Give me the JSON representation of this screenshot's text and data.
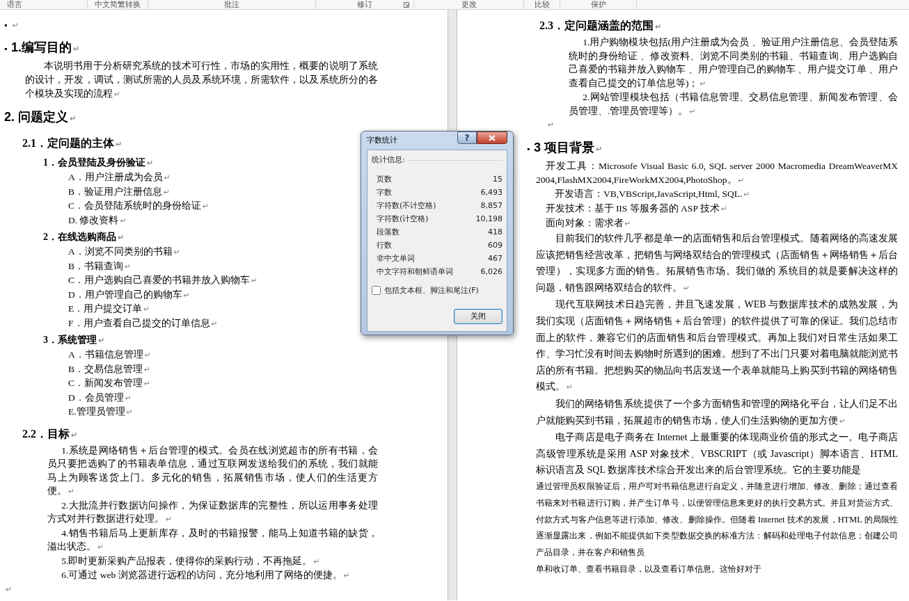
{
  "ribbon_groups": [
    {
      "label": "语言",
      "launcher": false
    },
    {
      "label": "中文简繁转换",
      "launcher": false
    },
    {
      "label": "批注",
      "launcher": false
    },
    {
      "label": "修订",
      "launcher": true
    },
    {
      "label": "更改",
      "launcher": false
    },
    {
      "label": "比较",
      "launcher": false
    },
    {
      "label": "保护",
      "launcher": false
    }
  ],
  "left_page": {
    "blocks": [
      {
        "kind": "blank",
        "keep": "▪",
        "mark": "↵"
      },
      {
        "kind": "h1",
        "keep": "▪",
        "text": "1.编写目的",
        "mark": "↵"
      },
      {
        "kind": "para",
        "text": "本说明书用于分析研究系统的技术可行性，市场的实用性，概要的说明了系统的设计，开发，调试，测试所需的人员及系统环境，所需软件，以及系统所分的各个模块及实现的流程",
        "mark": "↵"
      },
      {
        "kind": "h1",
        "text": "2. 问题定义",
        "mark": "↵"
      },
      {
        "kind": "h2",
        "text": "2.1．定问题的主体",
        "mark": "↵"
      },
      {
        "kind": "sub",
        "text": "1．会员登陆及身份验证",
        "mark": "↵"
      },
      {
        "kind": "item",
        "text": "A．用户注册成为会员",
        "mark": "↵"
      },
      {
        "kind": "item",
        "text": "B．验证用户注册信息",
        "mark": "↵"
      },
      {
        "kind": "item",
        "text": "C．会员登陆系统时的身份给证",
        "mark": "↵"
      },
      {
        "kind": "item",
        "text": "D. 修改资料",
        "mark": "↵"
      },
      {
        "kind": "sub",
        "text": "2．在线选购商品",
        "mark": "↵"
      },
      {
        "kind": "item",
        "text": "A．浏览不同类别的书籍",
        "mark": "↵"
      },
      {
        "kind": "item",
        "text": "B．书籍查询",
        "mark": "↵"
      },
      {
        "kind": "item",
        "text": "C．用户选购自己喜爱的书籍并放入购物车",
        "mark": "↵"
      },
      {
        "kind": "item",
        "text": "D．用户管理自己的购物车",
        "mark": "↵"
      },
      {
        "kind": "item",
        "text": "E．用户提交订单",
        "mark": "↵"
      },
      {
        "kind": "item",
        "text": "F．用户查看自己提交的订单信息",
        "mark": "↵"
      },
      {
        "kind": "sub",
        "text": "3．系统管理",
        "mark": "↵"
      },
      {
        "kind": "item",
        "text": "A．书籍信息管理",
        "mark": "↵"
      },
      {
        "kind": "item",
        "text": "B．交易信息管理",
        "mark": "↵"
      },
      {
        "kind": "item",
        "text": "C．新闻发布管理",
        "mark": "↵"
      },
      {
        "kind": "item",
        "text": "D．会员管理",
        "mark": "↵"
      },
      {
        "kind": "item",
        "text": "E.管理员管理",
        "mark": "↵"
      },
      {
        "kind": "h2",
        "text": "2.2．目标",
        "mark": "↵"
      },
      {
        "kind": "goal",
        "text": "1.系统是网络销售＋后台管理的模式。会员在线浏览超市的所有书籍，会员只要把选购了的书籍表单信息，通过互联网发送给我们的系统，我们就能马上为顾客送货上门。多元化的销售，拓展销售市场，使人们的生活更方便。",
        "mark": "↵"
      },
      {
        "kind": "goal",
        "text": "2.大批流并行数据访问操作，为保证数据库的完整性，所以运用事务处理方式对并行数据进行处理。",
        "mark": "↵"
      },
      {
        "kind": "goal",
        "text": "4.销售书籍后马上更新库存，及时的书籍报警，能马上知道书籍的缺货，溢出状态。",
        "mark": "↵"
      },
      {
        "kind": "goal",
        "text": "5.即时更新采购产品报表，使得你的采购行动，不再拖延。",
        "mark": "↵"
      },
      {
        "kind": "goal",
        "text": "6.可通过 web 浏览器进行远程的访问，充分地利用了网络的便捷。",
        "mark": "↵"
      },
      {
        "kind": "blank",
        "mark": "↵"
      }
    ]
  },
  "right_page": {
    "blocks": [
      {
        "kind": "h2",
        "text": "2.3．定问题涵盖的范围",
        "mark": "↵"
      },
      {
        "kind": "goal",
        "text": "1.用户购物模块包括(用户注册成为会员 、验证用户注册信息、会员登陆系统时的身份给证 、修改资料、浏览不同类别的书籍、书籍查询、用户选购自己喜爱的书籍并放入购物车 、用户管理自己的购物车 、用户提交订单 、用户查看自己提交的订单信息等)；",
        "mark": "↵"
      },
      {
        "kind": "goal",
        "text": "2.网站管理模块包括（书籍信息管理、交易信息管理、新闻发布管理、会员管理、.管理员管理等）。",
        "mark": "↵"
      },
      {
        "kind": "blank",
        "mark": "↵"
      },
      {
        "kind": "h1",
        "keep": "▪",
        "text": "3 项目背景",
        "mark": "↵"
      },
      {
        "kind": "plain",
        "text": "开发工具：Microsofe Visual Basic 6.0, SQL server 2000 Macromedia DreamWeaverMX 2004,FlashMX2004,FireWorkMX2004,PhotoShop。",
        "mark": "↵"
      },
      {
        "kind": "para",
        "text": "开发语言：VB,VBScript,JavaScript,Html, SQL.",
        "mark": "↵"
      },
      {
        "kind": "plain",
        "text": "开发技术：基于 IIS 等服务器的 ASP 技术",
        "mark": "↵"
      },
      {
        "kind": "plain",
        "text": "面向对象：需求者",
        "mark": "↵"
      },
      {
        "kind": "loose",
        "text": "目前我们的软件几乎都是单一的店面销售和后台管理模式。随着网络的高速发展应该把销售经营改革，把销售与网络双结合的管理模式（店面销售＋网络销售＋后台管理），实现多方面的销售。拓展销售市场。我们做的 系统目的就是要解决这样的问题，销售跟网络双结合的软件。",
        "mark": "↵"
      },
      {
        "kind": "loose",
        "text": "现代互联网技术日趋完善，并且飞速发展，WEB 与数据库技术的成熟发展，为我们实现（店面销售＋网络销售＋后台管理）的软件提供了可靠的保证。我们总结市面上的软件，兼容它们的店面销售和后台管理模式。再加上我们对日常生活如果工作、学习忙没有时间去购物时所遇到的困难。想到了不出门只要对着电脑就能浏览书店的所有书籍。把想购买的物品向书店发送一个表单就能马上购买到书籍的网络销售模式。",
        "mark": "↵"
      },
      {
        "kind": "loose",
        "text": "我们的网络销售系统提供了一个多方面销售和管理的网络化平台，让人们足不出户就能购买到书籍，拓展超市的销售市场，使人们生活购物的更加方便",
        "mark": "↵"
      },
      {
        "kind": "loose",
        "text": "电子商店是电子商务在 Internet 上最重要的体现商业价值的形式之一。电子商店高级管理系统是采用 ASP 对象技术、VBSCRIPT（或 Javascript）脚本语言、HTML 标识语言及 SQL 数据库技术综合开发出来的后台管理系统。它的主要功能是"
      },
      {
        "kind": "small",
        "text": "通过管理员权限验证后，用户可对书籍信息进行自定义，并随意进行增加、修改、删除；通过查看书籍来对书籍进行订购，并产生订单号，以便管理信息来更好的执行交易方式。并且对货运方式、付款方式与客户信息等进行添加、修改、删除操作。但随着 Internet 技术的发展，HTML 的局限性逐渐显露出来，例如不能提供如下类型数据交换的标准方法：解码和处理电子付款信息；创建公司产品目录，并在客户和销售员"
      },
      {
        "kind": "small_cont",
        "text": "单和收订单、查看书籍目录，以及查看订单信息。这恰好对于"
      }
    ]
  },
  "dialog": {
    "title": "字数统计",
    "help": "?",
    "group": "统计信息:",
    "stats": [
      {
        "label": "页数",
        "value": "15"
      },
      {
        "label": "字数",
        "value": "6,493"
      },
      {
        "label": "字符数(不计空格)",
        "value": "8,857"
      },
      {
        "label": "字符数(计空格)",
        "value": "10,198"
      },
      {
        "label": "段落数",
        "value": "418"
      },
      {
        "label": "行数",
        "value": "609"
      },
      {
        "label": "非中文单词",
        "value": "467"
      },
      {
        "label": "中文字符和朝鲜语单词",
        "value": "6,026"
      }
    ],
    "include_textboxes": {
      "label": "包括文本框、脚注和尾注(F)",
      "checked": false
    },
    "close_label": "关闭"
  }
}
